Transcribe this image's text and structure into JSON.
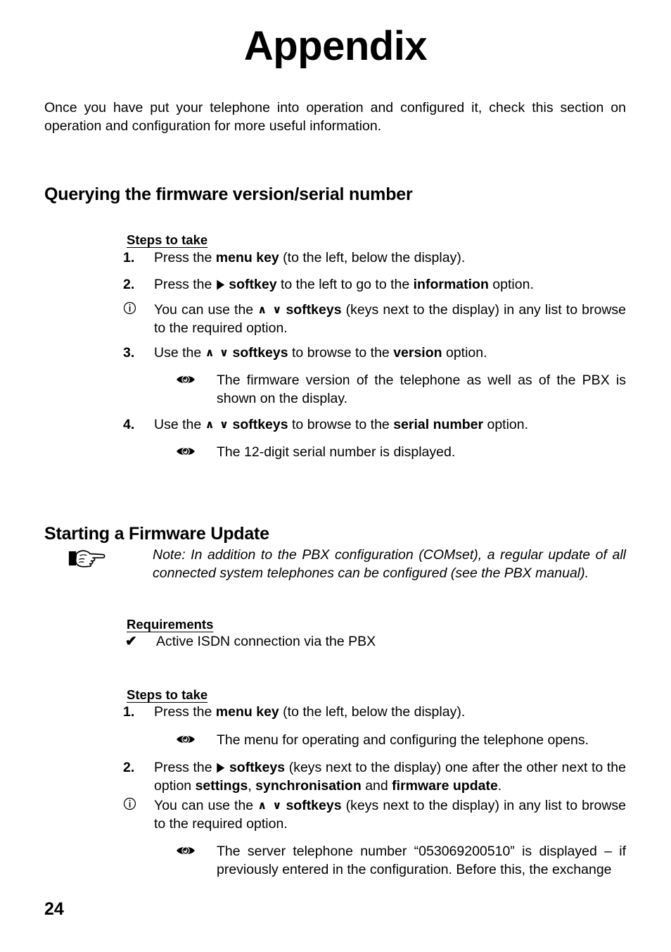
{
  "document": {
    "title": "Appendix",
    "page_number": "24",
    "intro_paragraph": "Once you have put your telephone into operation and configured it, check this section on operation and configuration for more useful information."
  },
  "sections": {
    "querying": {
      "heading": "Querying the firmware version/serial number",
      "steps_label": "Steps to take",
      "steps": [
        {
          "number": "1.",
          "text_parts": [
            "Press the ",
            "menu key",
            " (to the left, below the display)."
          ]
        },
        {
          "number": "2.",
          "text_parts": [
            "Press the ",
            "softkey",
            " to the left to go to the ",
            "information",
            " option."
          ]
        },
        {
          "number": "3.",
          "text_parts": [
            "Use the ",
            "softkeys",
            " to browse to the ",
            "version",
            " option."
          ]
        },
        {
          "number": "4.",
          "text_parts": [
            "Use the ",
            "softkeys",
            " to browse to the ",
            "serial number",
            " option."
          ]
        }
      ],
      "info_note": {
        "icon": "info-circle-icon",
        "text_parts": [
          "You can use the ",
          "softkeys",
          " (keys next to the display) in any list to browse to the required option."
        ]
      },
      "result_version": {
        "icon": "eye-icon",
        "text": "The firmware version of the telephone as well as of the PBX is shown on the display."
      },
      "result_serial": {
        "icon": "eye-icon",
        "text": "The 12-digit serial number is displayed."
      }
    },
    "firmware_update": {
      "heading": "Starting a Firmware Update",
      "note": {
        "icon": "pointing-hand-icon",
        "text": "Note: In addition to the PBX configuration (COMset), a regular update of all connected system telephones can be configured (see the PBX manual)."
      },
      "requirements_label": "Requirements",
      "requirement_item": {
        "icon": "check-icon",
        "text": "Active ISDN connection via the PBX"
      },
      "steps_label": "Steps to take",
      "steps": [
        {
          "number": "1.",
          "text_parts": [
            "Press the ",
            "menu key",
            " (to the left, below the display)."
          ]
        },
        {
          "number": "2.",
          "text_parts": [
            "Press the ",
            "softkeys",
            " (keys next to the display) one after the other next to the option ",
            "settings",
            ", ",
            "synchronisation",
            " and ",
            "firmware update",
            "."
          ]
        }
      ],
      "result_menu": {
        "icon": "eye-icon",
        "text": "The menu for operating and configuring the telephone opens."
      },
      "info_note": {
        "icon": "info-circle-icon",
        "text_parts": [
          "You can use the ",
          "softkeys",
          " (keys next to the display) in any list to browse to the required option."
        ]
      },
      "result_server_number": {
        "icon": "eye-icon",
        "server_telephone_number": "053069200510",
        "text": "The server telephone number “053069200510” is displayed – if previously entered in the configuration. Before this, the exchange"
      }
    }
  },
  "glyphs": {
    "softkey_right": "▶",
    "softkey_up": "∧",
    "softkey_down": "∨",
    "check": "✔"
  },
  "colors": {
    "text": "#000000",
    "background": "#ffffff"
  }
}
